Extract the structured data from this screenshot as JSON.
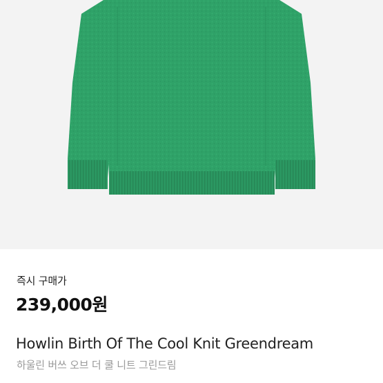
{
  "product": {
    "image_alt": "green knit sweater",
    "sweater_color": "#2fa268",
    "purchase_label": "즉시 구매가",
    "price": "239,000원",
    "title_en": "Howlin Birth Of The Cool Knit Greendream",
    "title_ko": "하울린 버쓰 오브 더 쿨 니트 그린드림"
  }
}
